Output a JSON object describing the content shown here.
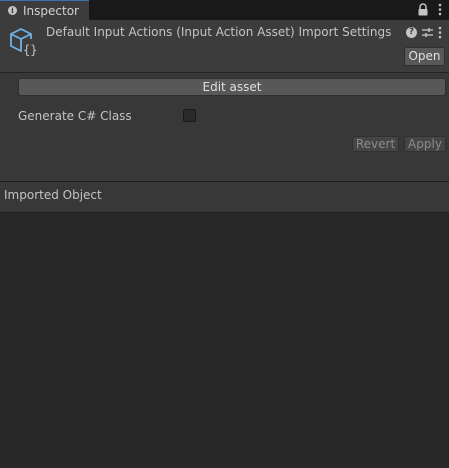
{
  "tab": {
    "label": "Inspector",
    "icon": "info-icon"
  },
  "header": {
    "title": "Default Input Actions (Input Action Asset) Import Settings",
    "open_label": "Open",
    "icons": [
      "input-action-asset-icon",
      "help-icon",
      "presets-icon",
      "menu-dots-icon"
    ]
  },
  "importer": {
    "edit_asset_label": "Edit asset",
    "generate_class_label": "Generate C# Class",
    "generate_class_checked": false,
    "revert_label": "Revert",
    "apply_label": "Apply"
  },
  "imported_object": {
    "title": "Imported Object"
  },
  "colors": {
    "background": "#282828",
    "panel": "#383838",
    "header": "#3c3c3c",
    "tab_accent": "#3a72b0",
    "asset_icon": "#6fb3e8"
  }
}
